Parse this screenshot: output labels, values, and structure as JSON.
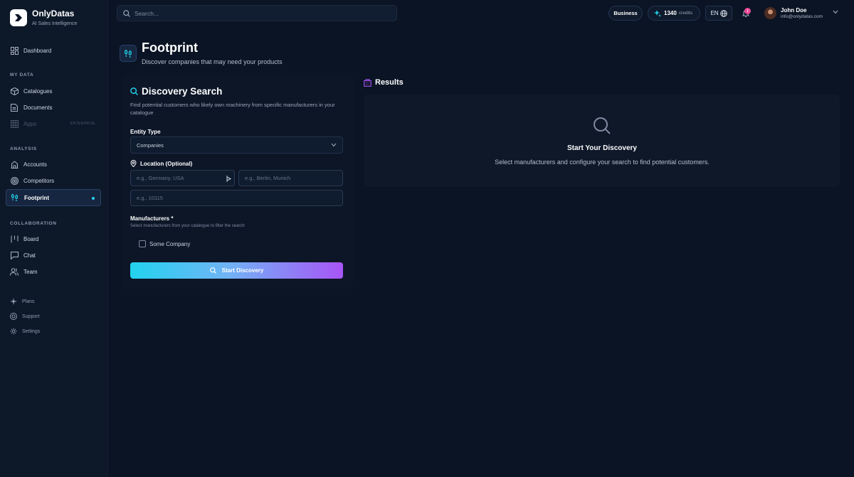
{
  "brand": {
    "name": "OnlyDatas",
    "tagline": "AI Sales Intelligence"
  },
  "search": {
    "placeholder": "Search..."
  },
  "topbar": {
    "plan": "Business",
    "credits_value": "1340",
    "credits_label": "credits",
    "language": "EN",
    "notification_count": "1",
    "user_name": "John Doe",
    "user_email": "info@onlydatas.com"
  },
  "sidebar": {
    "dashboard": "Dashboard",
    "section_my_data": "MY DATA",
    "catalogues": "Catalogues",
    "documents": "Documents",
    "apps": "Apps",
    "apps_badge": "ENTERPRISE",
    "section_analysis": "ANALYSIS",
    "accounts": "Accounts",
    "competitors": "Competitors",
    "footprint": "Footprint",
    "section_collaboration": "COLLABORATION",
    "board": "Board",
    "chat": "Chat",
    "team": "Team",
    "plans": "Plans",
    "support": "Support",
    "settings": "Settings"
  },
  "page": {
    "title": "Footprint",
    "subtitle": "Discover companies that may need your products"
  },
  "discovery": {
    "title": "Discovery Search",
    "description": "Find potential customers who likely own machinery from specific manufacturers in your catalogue",
    "entity_type_label": "Entity Type",
    "entity_type_value": "Companies",
    "location_label": "Location (Optional)",
    "country_placeholder": "e.g., Germany, USA",
    "city_placeholder": "e.g., Berlin, Munich",
    "postal_placeholder": "e.g., 10115",
    "manufacturers_label": "Manufacturers *",
    "manufacturers_hint": "Select manufacturers from your catalogue to filter the search",
    "manufacturer_option": "Some Company",
    "start_button": "Start Discovery"
  },
  "results": {
    "title": "Results",
    "empty_title": "Start Your Discovery",
    "empty_description": "Select manufacturers and configure your search to find potential customers."
  },
  "colors": {
    "background": "#0b1424",
    "accent_cyan": "#22d3ee",
    "accent_purple": "#a855f7",
    "notification": "#ec4899"
  }
}
